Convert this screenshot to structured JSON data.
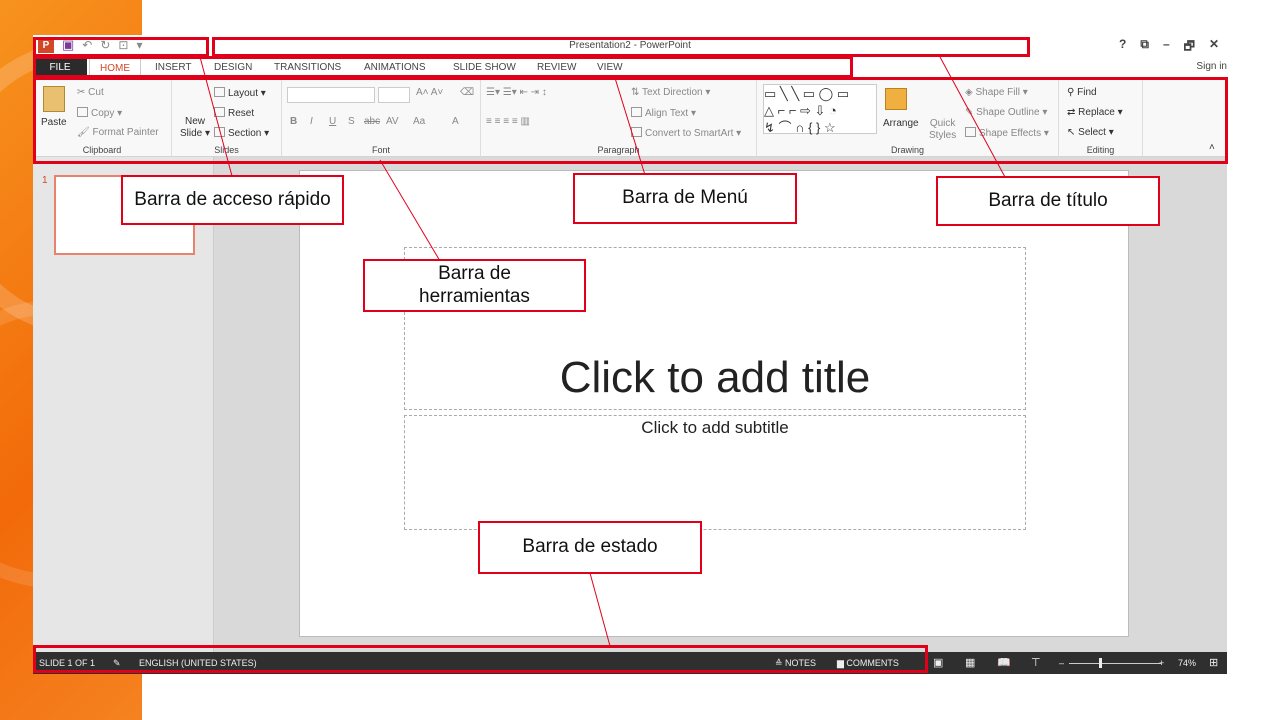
{
  "app": {
    "window_title": "Presentation2 - PowerPoint",
    "qat_icons": [
      "powerpoint-logo-icon",
      "save-icon",
      "undo-icon",
      "redo-icon",
      "start-presentation-icon",
      "customize-qat-icon"
    ],
    "window_controls": [
      "?",
      "⧉",
      "–",
      "🗗",
      "✕"
    ],
    "sign_in": "Sign in"
  },
  "tabs": [
    {
      "label": "FILE"
    },
    {
      "label": "HOME"
    },
    {
      "label": "INSERT"
    },
    {
      "label": "DESIGN"
    },
    {
      "label": "TRANSITIONS"
    },
    {
      "label": "ANIMATIONS"
    },
    {
      "label": "SLIDE SHOW"
    },
    {
      "label": "REVIEW"
    },
    {
      "label": "VIEW"
    }
  ],
  "ribbon": {
    "clipboard": {
      "label": "Clipboard",
      "paste": "Paste",
      "cut": "Cut",
      "copy": "Copy",
      "format_painter": "Format Painter"
    },
    "slides": {
      "label": "Slides",
      "new_slide_1": "New",
      "new_slide_2": "Slide",
      "layout": "Layout",
      "reset": "Reset",
      "section": "Section"
    },
    "font": {
      "label": "Font",
      "bold": "B",
      "italic": "I",
      "underline": "U",
      "shadow": "S",
      "strike": "abc",
      "spacing": "AV",
      "case": "Aa",
      "color": "A"
    },
    "paragraph": {
      "label": "Paragraph",
      "text_direction": "Text Direction",
      "align_text": "Align Text",
      "convert": "Convert to SmartArt"
    },
    "drawing": {
      "label": "Drawing",
      "arrange": "Arrange",
      "quick_styles_1": "Quick",
      "quick_styles_2": "Styles",
      "shape_fill": "Shape Fill",
      "shape_outline": "Shape Outline",
      "shape_effects": "Shape Effects"
    },
    "editing": {
      "label": "Editing",
      "find": "Find",
      "replace": "Replace",
      "select": "Select"
    }
  },
  "slides_pane": {
    "number": "1"
  },
  "slide": {
    "title_placeholder": "Click to add title",
    "subtitle_placeholder": "Click to add subtitle"
  },
  "status": {
    "slide": "SLIDE 1 OF 1",
    "language": "ENGLISH (UNITED STATES)",
    "notes": "NOTES",
    "comments": "COMMENTS",
    "zoom": "74%"
  },
  "annotations": {
    "quick_access": "Barra de acceso rápido",
    "menu": "Barra de Menú",
    "title": "Barra de título",
    "tools_1": "Barra de",
    "tools_2": "herramientas",
    "status": "Barra de estado"
  },
  "colors": {
    "accent": "#d24726",
    "highlight": "#e1001a",
    "orange": "#f26a0a"
  }
}
